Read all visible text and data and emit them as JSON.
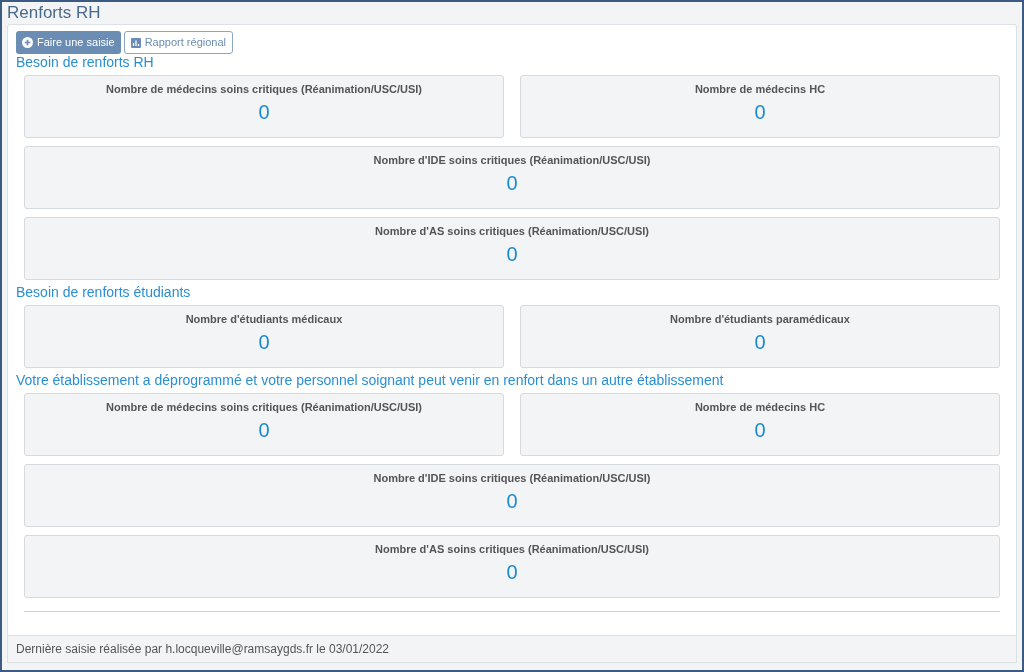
{
  "window": {
    "title": "Renforts RH"
  },
  "toolbar": [
    {
      "kind": "primary",
      "label": "Faire une saisie"
    },
    {
      "kind": "secondary",
      "label": "Rapport régional"
    }
  ],
  "sections": [
    {
      "title": "Besoin de renforts RH",
      "rows": [
        [
          {
            "label": "Nombre de médecins soins critiques (Réanimation/USC/USI)",
            "value": "0"
          },
          {
            "label": "Nombre de médecins HC",
            "value": "0"
          }
        ],
        [
          {
            "label": "Nombre d'IDE soins critiques (Réanimation/USC/USI)",
            "value": "0"
          }
        ],
        [
          {
            "label": "Nombre d'AS soins critiques (Réanimation/USC/USI)",
            "value": "0"
          }
        ]
      ]
    },
    {
      "title": "Besoin de renforts étudiants",
      "rows": [
        [
          {
            "label": "Nombre d'étudiants médicaux",
            "value": "0"
          },
          {
            "label": "Nombre d'étudiants paramédicaux",
            "value": "0"
          }
        ]
      ]
    },
    {
      "title": "Votre établissement a déprogrammé et votre personnel soignant peut venir en renfort dans un autre établissement",
      "rows": [
        [
          {
            "label": "Nombre de médecins soins critiques (Réanimation/USC/USI)",
            "value": "0"
          },
          {
            "label": "Nombre de médecins HC",
            "value": "0"
          }
        ],
        [
          {
            "label": "Nombre d'IDE soins critiques (Réanimation/USC/USI)",
            "value": "0"
          }
        ],
        [
          {
            "label": "Nombre d'AS soins critiques (Réanimation/USC/USI)",
            "value": "0"
          }
        ]
      ]
    }
  ],
  "footer": "Dernière saisie réalisée par h.locqueville@ramsaygds.fr le 03/01/2022"
}
